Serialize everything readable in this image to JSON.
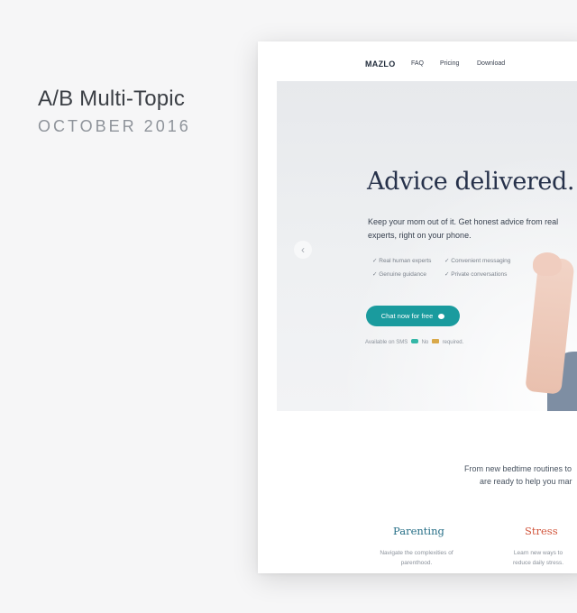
{
  "caption": {
    "title": "A/B Multi-Topic",
    "date": "OCTOBER 2016"
  },
  "site": {
    "logo": "MAZLO",
    "nav": [
      "FAQ",
      "Pricing",
      "Download"
    ],
    "hero": {
      "title": "Advice delivered.",
      "subtitle": "Keep your mom out of it. Get honest advice from real experts, right on your phone.",
      "features": [
        "✓ Real human experts",
        "✓ Convenient messaging",
        "✓ Genuine guidance",
        "✓ Private conversations"
      ],
      "cta_label": "Chat now for free",
      "availability": {
        "part1": "Available on SMS",
        "part2": "No",
        "part3": "required."
      },
      "carousel_prev": "‹"
    },
    "intro": {
      "line1": "From new bedtime routines to",
      "line2": "are ready to help you mar"
    },
    "topics": [
      {
        "title": "Parenting",
        "description": "Navigate the complexities of parenthood."
      },
      {
        "title": "Stress",
        "description": "Learn new ways to reduce daily stress."
      }
    ]
  },
  "colors": {
    "accent": "#1a9b9e",
    "parenting": "#256e86",
    "stress": "#d1563d",
    "heading": "#26314a"
  },
  "icons": [
    "chevron-left-icon",
    "chat-bubble-icon",
    "sms-badge-icon",
    "credit-card-icon"
  ]
}
